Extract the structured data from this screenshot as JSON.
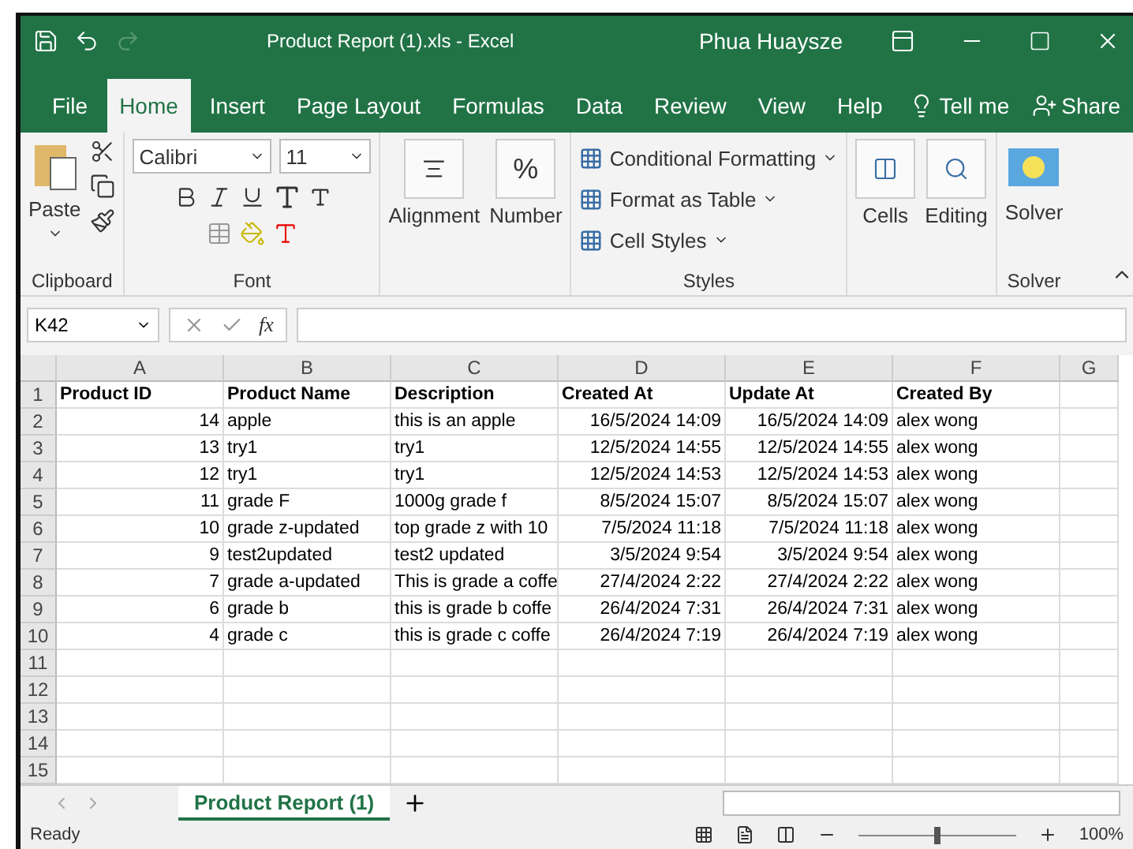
{
  "window": {
    "title": "Product Report (1).xls  -  Excel",
    "user": "Phua Huaysze"
  },
  "ribbon_tabs": [
    {
      "label": "File",
      "selected": false
    },
    {
      "label": "Home",
      "selected": true
    },
    {
      "label": "Insert",
      "selected": false
    },
    {
      "label": "Page Layout",
      "selected": false
    },
    {
      "label": "Formulas",
      "selected": false
    },
    {
      "label": "Data",
      "selected": false
    },
    {
      "label": "Review",
      "selected": false
    },
    {
      "label": "View",
      "selected": false
    },
    {
      "label": "Help",
      "selected": false
    }
  ],
  "tell_me": "Tell me",
  "share": "Share",
  "clipboard": {
    "paste": "Paste",
    "label": "Clipboard"
  },
  "font": {
    "name": "Calibri",
    "size": "11",
    "label": "Font"
  },
  "alignment": "Alignment",
  "number": "Number",
  "percent": "%",
  "styles": {
    "items": [
      "Conditional Formatting",
      "Format as Table",
      "Cell Styles"
    ],
    "label": "Styles"
  },
  "cells": "Cells",
  "editing": "Editing",
  "solver": {
    "button": "Solver",
    "label": "Solver"
  },
  "name_box": "K42",
  "fx": "fx",
  "columns": [
    "A",
    "B",
    "C",
    "D",
    "E",
    "F",
    "G"
  ],
  "header_row": [
    "Product ID",
    "Product Name",
    "Description",
    "Created At",
    "Update At",
    "Created By"
  ],
  "rows": [
    [
      "14",
      "apple",
      "this is an apple",
      "16/5/2024 14:09",
      "16/5/2024 14:09",
      "alex wong"
    ],
    [
      "13",
      "try1",
      "try1",
      "12/5/2024 14:55",
      "12/5/2024 14:55",
      "alex wong"
    ],
    [
      "12",
      "try1",
      "try1",
      "12/5/2024 14:53",
      "12/5/2024 14:53",
      "alex wong"
    ],
    [
      "11",
      "grade F",
      "1000g grade f",
      "8/5/2024 15:07",
      "8/5/2024 15:07",
      "alex wong"
    ],
    [
      "10",
      "grade z-updated",
      "top grade z with 10",
      "7/5/2024 11:18",
      "7/5/2024 11:18",
      "alex wong"
    ],
    [
      "9",
      "test2updated",
      "test2 updated",
      "3/5/2024 9:54",
      "3/5/2024 9:54",
      "alex wong"
    ],
    [
      "7",
      "grade a-updated",
      "This is grade a coffe",
      "27/4/2024 2:22",
      "27/4/2024 2:22",
      "alex wong"
    ],
    [
      "6",
      "grade b",
      "this is grade b coffe",
      "26/4/2024 7:31",
      "26/4/2024 7:31",
      "alex wong"
    ],
    [
      "4",
      "grade c",
      "this is grade c coffe",
      "26/4/2024 7:19",
      "26/4/2024 7:19",
      "alex wong"
    ]
  ],
  "row_numbers": [
    "1",
    "2",
    "3",
    "4",
    "5",
    "6",
    "7",
    "8",
    "9",
    "10",
    "11",
    "12",
    "13",
    "14",
    "15"
  ],
  "sheet_tabs": [
    {
      "label": "Product Report (1)",
      "selected": true
    }
  ],
  "status": "Ready",
  "zoom": {
    "reading": "100%",
    "level": 0.5
  }
}
